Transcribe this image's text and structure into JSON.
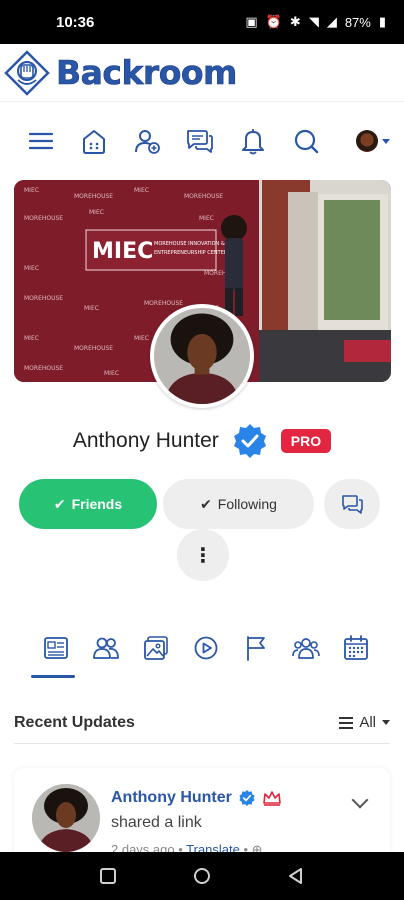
{
  "status_bar": {
    "time": "10:36",
    "battery": "87%"
  },
  "app": {
    "name": "Backroom",
    "brand_color": "#2a56a8"
  },
  "toolbar": {
    "icons": [
      "menu-icon",
      "home-icon",
      "add-friend-icon",
      "messages-icon",
      "notifications-icon",
      "search-icon"
    ]
  },
  "profile": {
    "name": "Anthony Hunter",
    "badge": "PRO",
    "cover_text": {
      "logo": "MIEC",
      "subtitle": "MORGAN'S INNOVATION & ENTREPRENEURSHIP CENTER",
      "repeat": "MIEC MOREHOUSE"
    }
  },
  "actions": {
    "friends_label": "Friends",
    "following_label": "Following",
    "more_label": "⋮"
  },
  "tabs": [
    "timeline-icon",
    "friends-icon",
    "photos-icon",
    "videos-icon",
    "pages-icon",
    "groups-icon",
    "events-icon"
  ],
  "feed": {
    "title": "Recent Updates",
    "filter_label": "All",
    "post": {
      "author": "Anthony Hunter",
      "action": "shared a link",
      "time": "2 days ago",
      "translate": "Translate"
    }
  }
}
